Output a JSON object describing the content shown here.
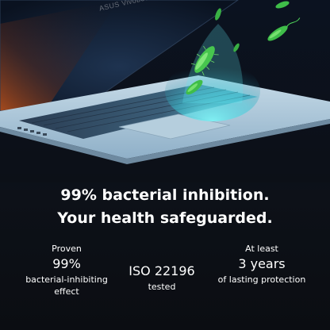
{
  "hero": {
    "brand_text": "ASUS Vivobook",
    "colors": {
      "chassis": "#a8c2d6",
      "keyboard_glow": "#5ee0e8",
      "bacteria": "#4fd65a",
      "background": "#0b0f17"
    }
  },
  "headline": {
    "line1": "99% bacterial inhibition.",
    "line2": "Your health safeguarded."
  },
  "stats": {
    "left": {
      "top": "Proven",
      "value": "99%",
      "bottom1": "bacterial-inhibiting",
      "bottom2": "effect"
    },
    "middle": {
      "value": "ISO 22196",
      "bottom": "tested"
    },
    "right": {
      "top": "At least",
      "value": "3 years",
      "bottom": "of lasting protection"
    }
  }
}
